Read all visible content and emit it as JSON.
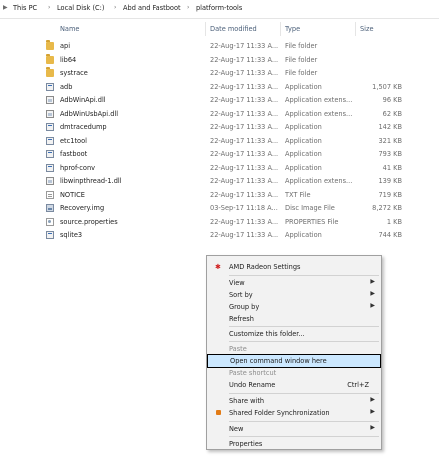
{
  "breadcrumb": {
    "items": [
      "This PC",
      "Local Disk (C:)",
      "Abd and Fastboot",
      "platform-tools"
    ]
  },
  "columns": {
    "name": "Name",
    "date": "Date modified",
    "type": "Type",
    "size": "Size"
  },
  "files": [
    {
      "name": "api",
      "date": "22-Aug-17 11:33 A...",
      "type": "File folder",
      "size": "",
      "icon": "folder-icon"
    },
    {
      "name": "lib64",
      "date": "22-Aug-17 11:33 A...",
      "type": "File folder",
      "size": "",
      "icon": "folder-icon"
    },
    {
      "name": "systrace",
      "date": "22-Aug-17 11:33 A...",
      "type": "File folder",
      "size": "",
      "icon": "folder-icon"
    },
    {
      "name": "adb",
      "date": "22-Aug-17 11:33 A...",
      "type": "Application",
      "size": "1,507 KB",
      "icon": "application-icon"
    },
    {
      "name": "AdbWinApi.dll",
      "date": "22-Aug-17 11:33 A...",
      "type": "Application extens...",
      "size": "96 KB",
      "icon": "dll-icon"
    },
    {
      "name": "AdbWinUsbApi.dll",
      "date": "22-Aug-17 11:33 A...",
      "type": "Application extens...",
      "size": "62 KB",
      "icon": "dll-icon"
    },
    {
      "name": "dmtracedump",
      "date": "22-Aug-17 11:33 A...",
      "type": "Application",
      "size": "142 KB",
      "icon": "application-icon"
    },
    {
      "name": "etc1tool",
      "date": "22-Aug-17 11:33 A...",
      "type": "Application",
      "size": "321 KB",
      "icon": "application-icon"
    },
    {
      "name": "fastboot",
      "date": "22-Aug-17 11:33 A...",
      "type": "Application",
      "size": "793 KB",
      "icon": "application-icon"
    },
    {
      "name": "hprof-conv",
      "date": "22-Aug-17 11:33 A...",
      "type": "Application",
      "size": "41 KB",
      "icon": "application-icon"
    },
    {
      "name": "libwinpthread-1.dll",
      "date": "22-Aug-17 11:33 A...",
      "type": "Application extens...",
      "size": "139 KB",
      "icon": "dll-icon"
    },
    {
      "name": "NOTICE",
      "date": "22-Aug-17 11:33 A...",
      "type": "TXT File",
      "size": "719 KB",
      "icon": "text-file-icon"
    },
    {
      "name": "Recovery.img",
      "date": "03-Sep-17 11:18 A...",
      "type": "Disc Image File",
      "size": "8,272 KB",
      "icon": "disc-image-icon"
    },
    {
      "name": "source.properties",
      "date": "22-Aug-17 11:33 A...",
      "type": "PROPERTIES File",
      "size": "1 KB",
      "icon": "properties-file-icon"
    },
    {
      "name": "sqlite3",
      "date": "22-Aug-17 11:33 A...",
      "type": "Application",
      "size": "744 KB",
      "icon": "application-icon"
    }
  ],
  "context_menu": {
    "amd": "AMD Radeon Settings",
    "view": "View",
    "sort_by": "Sort by",
    "group_by": "Group by",
    "refresh": "Refresh",
    "customize": "Customize this folder...",
    "paste": "Paste",
    "open_cmd": "Open command window here",
    "paste_shortcut": "Paste shortcut",
    "undo_rename": "Undo Rename",
    "undo_shortcut": "Ctrl+Z",
    "share_with": "Share with",
    "shared_sync": "Shared Folder Synchronization",
    "new": "New",
    "properties": "Properties"
  },
  "colors": {
    "highlight": "#cce8ff",
    "folder": "#e8b94a",
    "header_text": "#4c607a"
  }
}
